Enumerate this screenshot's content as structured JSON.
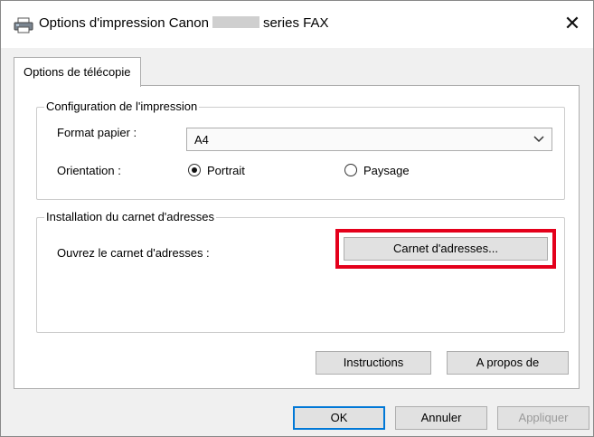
{
  "window": {
    "title_prefix": "Options d'impression Canon",
    "title_suffix": "series FAX",
    "close_symbol": "✕"
  },
  "tabs": [
    {
      "label": "Options de télécopie",
      "active": true
    }
  ],
  "print_config": {
    "legend": "Configuration de l'impression",
    "paper_label": "Format papier :",
    "paper_value": "A4",
    "orientation_label": "Orientation :",
    "portrait_label": "Portrait",
    "landscape_label": "Paysage",
    "orientation_selected": "portrait"
  },
  "address_book": {
    "legend": "Installation du carnet d'adresses",
    "open_label": "Ouvrez le carnet d'adresses :",
    "button_label": "Carnet d'adresses..."
  },
  "panel_buttons": {
    "instructions": "Instructions",
    "about": "A propos de"
  },
  "dialog_buttons": {
    "ok": "OK",
    "cancel": "Annuler",
    "apply": "Appliquer"
  },
  "colors": {
    "highlight": "#e4001b",
    "focus": "#0078d7"
  },
  "icons": {
    "title": "printer-icon",
    "close": "close-icon",
    "dropdown": "chevron-down-icon"
  }
}
